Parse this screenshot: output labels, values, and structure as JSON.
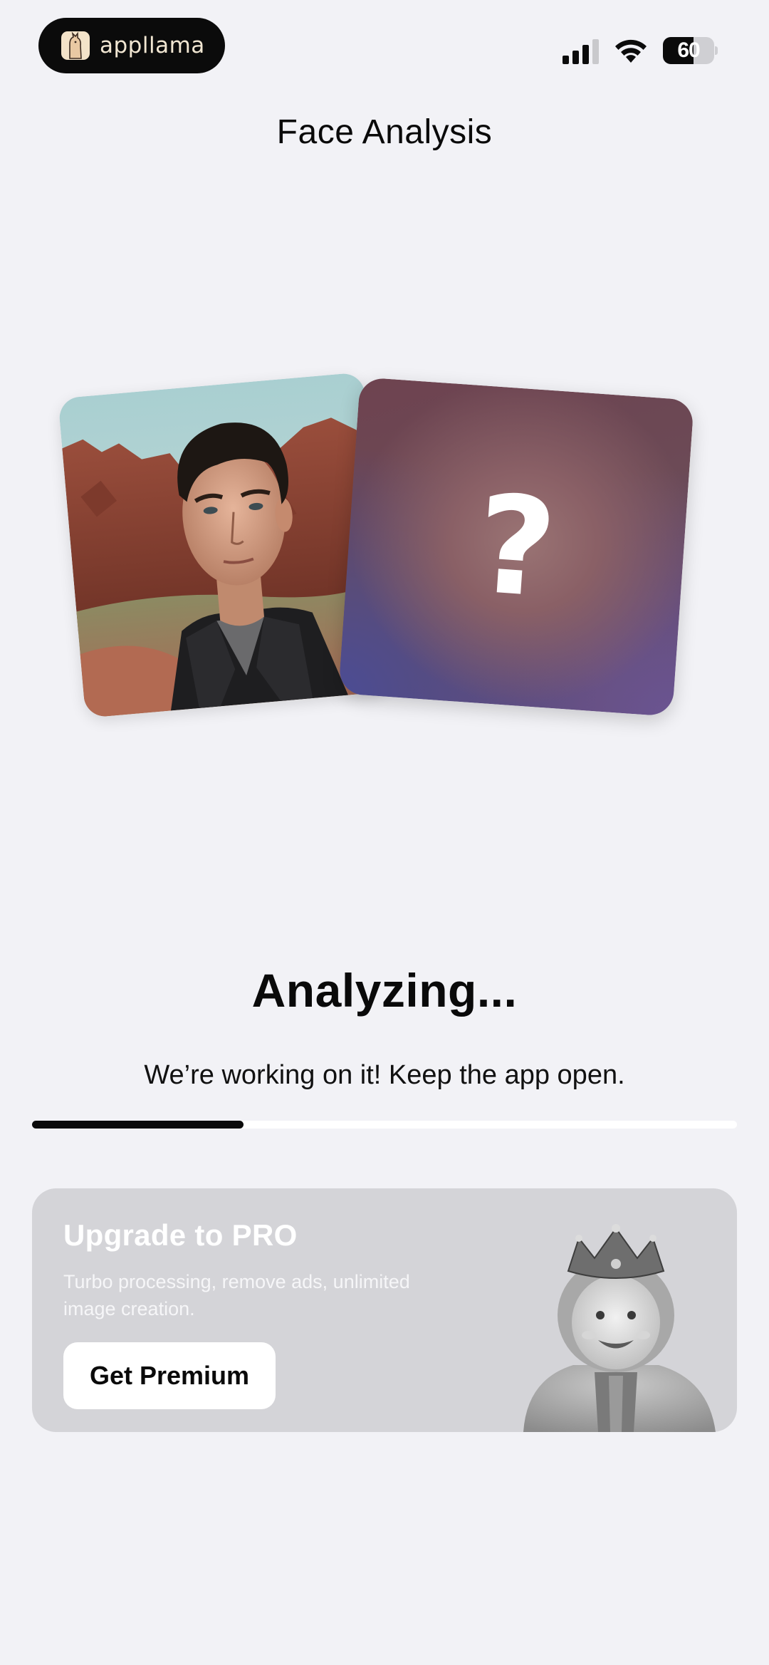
{
  "status_bar": {
    "brand": "appllama",
    "battery_level": "60",
    "battery_fraction": 0.6,
    "signal_icon": "cellular-signal-icon",
    "wifi_icon": "wifi-icon",
    "battery_icon": "battery-icon"
  },
  "header": {
    "title": "Face Analysis"
  },
  "cards": {
    "mystery_symbol": "?",
    "mystery_icon": "question-mark-icon"
  },
  "analysis": {
    "title": "Analyzing...",
    "subtitle": "We’re working on it! Keep the app open.",
    "progress_fraction": 0.3
  },
  "promo": {
    "title": "Upgrade to PRO",
    "description": "Turbo processing, remove ads, unlimited image creation.",
    "button_label": "Get Premium"
  },
  "colors": {
    "background": "#f2f2f6",
    "accent": "#0b0b0b",
    "promo_background": "#d4d4d8"
  }
}
